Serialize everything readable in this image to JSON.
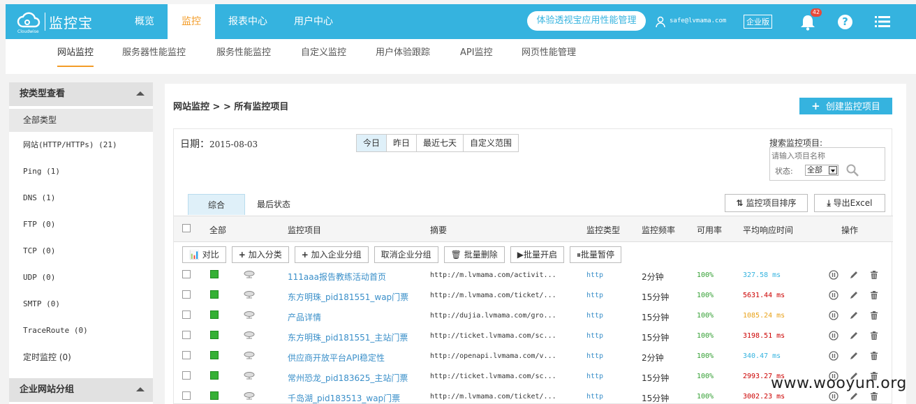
{
  "app": {
    "logo_name": "监控宝",
    "logo_caption": "Cloudwise",
    "brand_color": "#35b3df",
    "accent_color": "#f39c28"
  },
  "topnav": {
    "items": [
      {
        "label": "概览",
        "active": false
      },
      {
        "label": "监控",
        "active": true
      },
      {
        "label": "报表中心",
        "active": false
      },
      {
        "label": "用户中心",
        "active": false
      }
    ],
    "trial_button": "体验透视宝应用性能管理",
    "user_icon": "user-icon",
    "user_email": "safe@lvmama.com",
    "edition": "企业版",
    "notification_count": "42",
    "icons": [
      "bell-icon",
      "help-icon",
      "menu-icon"
    ]
  },
  "subnav": {
    "items": [
      {
        "label": "网站监控",
        "active": true
      },
      {
        "label": "服务器性能监控",
        "active": false
      },
      {
        "label": "服务性能监控",
        "active": false
      },
      {
        "label": "自定义监控",
        "active": false
      },
      {
        "label": "用户体验跟踪",
        "active": false
      },
      {
        "label": "API监控",
        "active": false
      },
      {
        "label": "网页性能管理",
        "active": false
      }
    ]
  },
  "sidebar": {
    "header": "按类型查看",
    "items": [
      {
        "label": "全部类型",
        "selected": true
      },
      {
        "label": "网站(HTTP/HTTPs) (21)"
      },
      {
        "label": "Ping (1)"
      },
      {
        "label": "DNS (1)"
      },
      {
        "label": "FTP (0)"
      },
      {
        "label": "TCP (0)"
      },
      {
        "label": "UDP (0)"
      },
      {
        "label": "SMTP (0)"
      },
      {
        "label": "TraceRoute (0)"
      },
      {
        "label": "定时监控 (0)"
      }
    ],
    "header2": "企业网站分组"
  },
  "main": {
    "breadcrumb": "网站监控 > > 所有监控项目",
    "create_button": "创建监控项目",
    "date_label": "日期：",
    "date_value": "2015-08-03",
    "range_buttons": [
      {
        "label": "今日",
        "active": true
      },
      {
        "label": "昨日",
        "active": false
      },
      {
        "label": "最近七天",
        "active": false
      },
      {
        "label": "自定义范围",
        "active": false
      }
    ],
    "search_label": "搜索监控项目:",
    "search_placeholder": "请输入项目名称",
    "status_label": "状态:",
    "status_value": "全部",
    "tabs": [
      {
        "label": "综合",
        "active": true
      },
      {
        "label": "最后状态",
        "active": false
      }
    ],
    "sort_button": "监控项目排序",
    "export_button": "导出Excel",
    "columns": {
      "all": "全部",
      "name": "监控项目",
      "summary": "摘要",
      "type": "监控类型",
      "freq": "监控频率",
      "avail": "可用率",
      "resp": "平均响应时间",
      "ops": "操作"
    },
    "bulk_actions": [
      "对比",
      "加入分类",
      "加入企业分组",
      "取消企业分组",
      "批量删除",
      "批量开启",
      "批量暂停"
    ],
    "rows": [
      {
        "name": "111aaa报告教练活动首页",
        "summary": "http://m.lvmama.com/activit...",
        "type": "http",
        "freq": "2分钟",
        "avail": "100%",
        "resp": "327.58 ms",
        "resp_color": "#35b3df"
      },
      {
        "name": "东方明珠_pid181551_wap门票",
        "summary": "http://m.lvmama.com/ticket/...",
        "type": "http",
        "freq": "15分钟",
        "avail": "100%",
        "resp": "5631.44 ms",
        "resp_color": "#cc0000"
      },
      {
        "name": "产品详情",
        "summary": "http://dujia.lvmama.com/gro...",
        "type": "http",
        "freq": "15分钟",
        "avail": "100%",
        "resp": "1085.24 ms",
        "resp_color": "#e8a21a"
      },
      {
        "name": "东方明珠_pid181551_主站门票",
        "summary": "http://ticket.lvmama.com/sc...",
        "type": "http",
        "freq": "15分钟",
        "avail": "100%",
        "resp": "3198.51 ms",
        "resp_color": "#cc0000"
      },
      {
        "name": "供应商开放平台API稳定性",
        "summary": "http://openapi.lvmama.com/v...",
        "type": "http",
        "freq": "2分钟",
        "avail": "100%",
        "resp": "340.47 ms",
        "resp_color": "#35b3df"
      },
      {
        "name": "常州恐龙_pid183625_主站门票",
        "summary": "http://ticket.lvmama.com/sc...",
        "type": "http",
        "freq": "15分钟",
        "avail": "100%",
        "resp": "2993.27 ms",
        "resp_color": "#cc0000"
      },
      {
        "name": "千岛湖_pid183513_wap门票",
        "summary": "http://m.lvmama.com/ticket/...",
        "type": "http",
        "freq": "15分钟",
        "avail": "100%",
        "resp": "3002.23 ms",
        "resp_color": "#cc0000"
      }
    ]
  },
  "watermark": "www.wooyun.org"
}
